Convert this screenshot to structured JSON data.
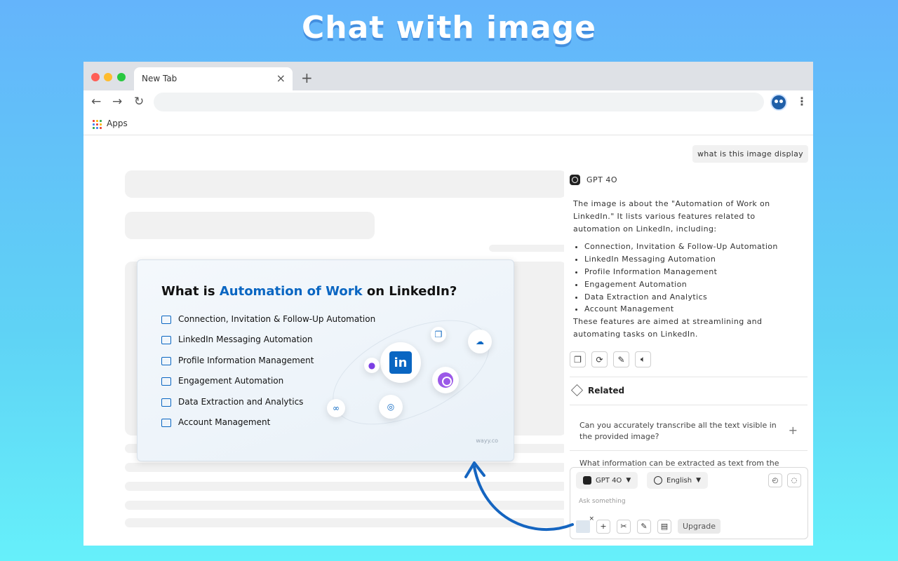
{
  "headline": "Chat with image",
  "browser": {
    "tab_title": "New Tab",
    "tab_close": "×",
    "new_tab": "+",
    "back": "←",
    "forward": "→",
    "reload": "↻",
    "menu": "⋮",
    "apps_label": "Apps",
    "apps_colors": [
      "#ea4335",
      "#fbbc05",
      "#34a853",
      "#4285f4",
      "#ea4335",
      "#fbbc05",
      "#34a853",
      "#4285f4",
      "#ea4335"
    ]
  },
  "card": {
    "title_prefix": "What is ",
    "title_accent": "Automation of Work",
    "title_suffix": " on LinkedIn?",
    "features": [
      "Connection, Invitation & Follow-Up Automation",
      "LinkedIn Messaging Automation",
      "Profile Information Management",
      "Engagement Automation",
      "Data Extraction and Analytics",
      "Account Management"
    ],
    "watermark": "wayy.co",
    "logo_text": "in",
    "accent_color": "#0a66c2"
  },
  "chat": {
    "user_message": "what is this image display",
    "model": "GPT 4O",
    "answer_intro": "The image is about the \"Automation of Work on LinkedIn.\" It lists various features related to automation on LinkedIn, including:",
    "answer_items": [
      "Connection, Invitation & Follow-Up Automation",
      "LinkedIn Messaging Automation",
      "Profile Information Management",
      "Engagement Automation",
      "Data Extraction and Analytics",
      "Account Management"
    ],
    "answer_outro": "These features are aimed at streamlining and automating tasks on LinkedIn.",
    "action_icons": [
      "copy-icon",
      "regenerate-icon",
      "edit-icon",
      "speaker-icon"
    ],
    "related_label": "Related",
    "related_questions": [
      "Can you accurately transcribe all the text visible in the provided image?",
      "What information can be extracted as text from the"
    ],
    "related_plus": "+"
  },
  "composer": {
    "model_pill": "GPT 4O",
    "language_pill": "English",
    "placeholder": "Ask something",
    "upgrade_label": "Upgrade",
    "thumb_close": "×",
    "tool_glyphs": [
      "+",
      "✂",
      "✎",
      "▤"
    ],
    "arrow_color": "#1565c0"
  }
}
